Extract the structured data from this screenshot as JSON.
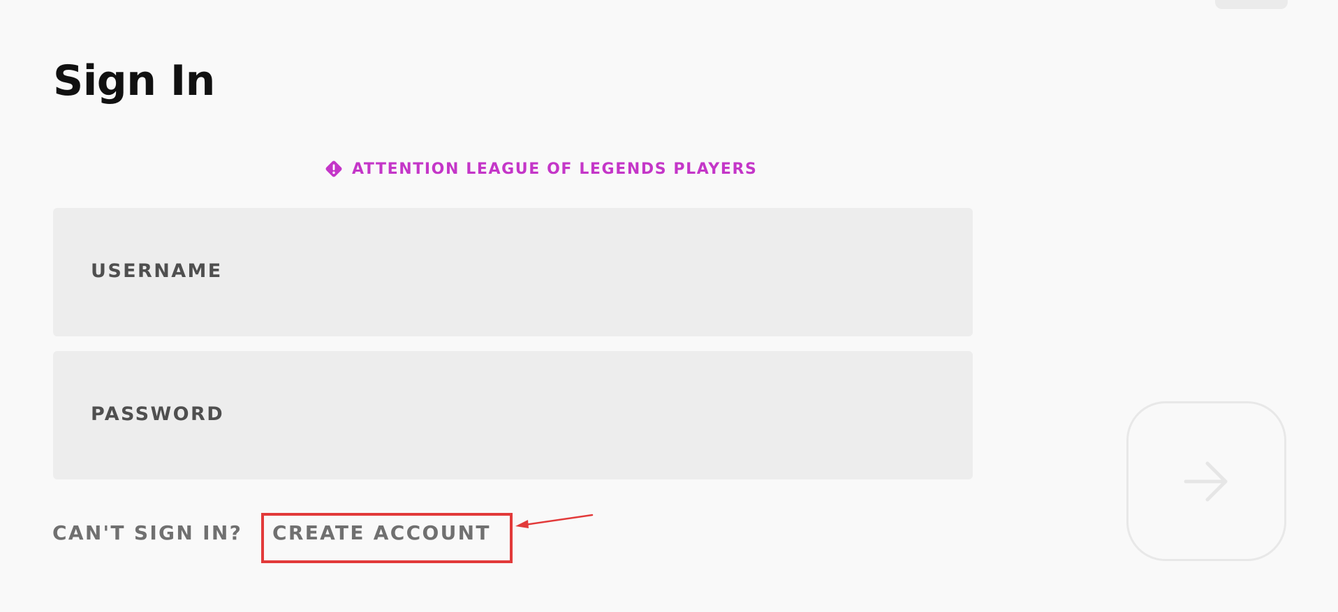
{
  "page": {
    "title": "Sign In"
  },
  "notice": {
    "icon": "warning-diamond-icon",
    "text": "ATTENTION LEAGUE OF LEGENDS PLAYERS",
    "color": "#c436c8"
  },
  "form": {
    "username_label": "USERNAME",
    "password_label": "PASSWORD",
    "username_value": "",
    "password_value": ""
  },
  "links": {
    "cant_sign_in": "CAN'T SIGN IN?",
    "create_account": "CREATE ACCOUNT"
  },
  "submit": {
    "icon": "arrow-right-icon",
    "state": "disabled"
  },
  "annotation": {
    "highlight_color": "#e23a3a",
    "target": "create-account-link"
  }
}
